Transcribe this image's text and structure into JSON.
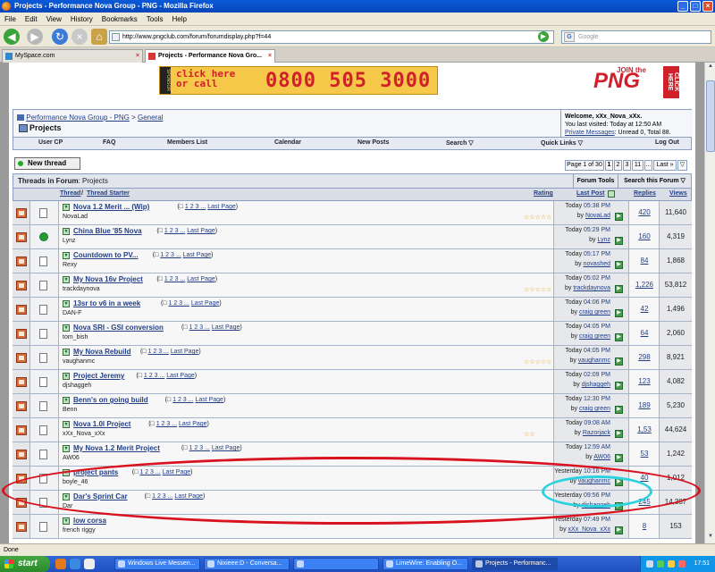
{
  "window": {
    "title": "Projects - Performance Nova Group - PNG - Mozilla Firefox"
  },
  "menu": [
    "File",
    "Edit",
    "View",
    "History",
    "Bookmarks",
    "Tools",
    "Help"
  ],
  "nav": {
    "url": "http://www.pngclub.com/forum/forumdisplay.php?f=44",
    "search_placeholder": "Google"
  },
  "tabs": [
    {
      "label": "MySpace.com"
    },
    {
      "label": "Projects - Performance Nova Gro..."
    }
  ],
  "banner": {
    "sponsor": "SPONSOR",
    "line1": "click here",
    "line2": "or call",
    "phone": "0800 505 3000",
    "png_join": "JOIN the",
    "png": "PNG",
    "png_click": "CLICK HERE"
  },
  "breadcrumb": {
    "home": "Performance Nova Group - PNG",
    "sep": ">",
    "section": "General",
    "current": "Projects"
  },
  "welcome": {
    "line1": "Welcome, xXx_Nova_xXx.",
    "line2": "You last visited: Today at 12:50 AM",
    "pm_link": "Private Messages",
    "pm_text": ": Unread 0, Total 88."
  },
  "forum_menu": [
    "User CP",
    "FAQ",
    "Members List",
    "Calendar",
    "New Posts",
    "Search ▽",
    "Quick Links ▽",
    "Log Out"
  ],
  "buttons": {
    "new_thread": "New thread"
  },
  "pagenav": {
    "label": "Page 1 of 30",
    "pages": [
      "1",
      "2",
      "3",
      "11",
      "...",
      "Last »",
      "▽"
    ]
  },
  "table": {
    "title": "Threads in Forum",
    "subtitle": ": Projects",
    "forum_tools": "Forum Tools ▽",
    "search_forum": "Search this Forum ▽",
    "headers": {
      "thread": "Thread",
      "slash": "/",
      "starter": "Thread Starter",
      "rating": "Rating",
      "lastpost": "Last Post",
      "replies": "Replies",
      "views": "Views"
    }
  },
  "threads": [
    {
      "title": "Nova 1.2 Merit ... (Wip)",
      "pages": "1 2 3 ...",
      "last": "Last Page",
      "starter": "NovaLad",
      "stars": "☆☆☆☆☆",
      "day": "Today",
      "time": "05:38 PM",
      "by": "by",
      "user": "NovaLad",
      "replies": "420",
      "views": "11,640"
    },
    {
      "title": "China Blue '85 Nova",
      "pages": "1 2 3 ...",
      "last": "Last Page",
      "starter": "Lynz",
      "stars": "",
      "day": "Today",
      "time": "05:29 PM",
      "by": "by",
      "user": "Lynz",
      "replies": "160",
      "views": "4,319"
    },
    {
      "title": "Countdown to PV...",
      "pages": "1 2 3 ...",
      "last": "Last Page",
      "starter": "Rexy",
      "stars": "",
      "day": "Today",
      "time": "05:17 PM",
      "by": "by",
      "user": "novashed",
      "replies": "84",
      "views": "1,868"
    },
    {
      "title": "My Nova 16v Project",
      "pages": "1 2 3 ...",
      "last": "Last Page",
      "starter": "trackdaynova",
      "stars": "☆☆☆☆☆",
      "day": "Today",
      "time": "05:02 PM",
      "by": "by",
      "user": "trackdaynova",
      "replies": "1,226",
      "views": "53,812"
    },
    {
      "title": "13sr to v6 in a week",
      "pages": "1 2 3 ...",
      "last": "Last Page",
      "starter": "DAN-F",
      "stars": "",
      "day": "Today",
      "time": "04:06 PM",
      "by": "by",
      "user": "craig green",
      "replies": "42",
      "views": "1,496"
    },
    {
      "title": "Nova SRI - GSI conversion",
      "pages": "1 2 3 ...",
      "last": "Last Page",
      "starter": "tom_bish",
      "stars": "",
      "day": "Today",
      "time": "04:05 PM",
      "by": "by",
      "user": "craig green",
      "replies": "64",
      "views": "2,060"
    },
    {
      "title": "My Nova Rebuild",
      "pages": "1 2 3 ...",
      "last": "Last Page",
      "starter": "vaughanmc",
      "stars": "☆☆☆☆☆",
      "day": "Today",
      "time": "04:05 PM",
      "by": "by",
      "user": "vaughanmc",
      "replies": "298",
      "views": "8,921"
    },
    {
      "title": "Project Jeremy",
      "pages": "1 2 3 ...",
      "last": "Last Page",
      "starter": "djshaggeh",
      "stars": "",
      "day": "Today",
      "time": "02:09 PM",
      "by": "by",
      "user": "djshaggeh",
      "replies": "123",
      "views": "4,082"
    },
    {
      "title": "Benn's on going build",
      "pages": "1 2 3 ...",
      "last": "Last Page",
      "starter": "Benn",
      "stars": "",
      "day": "Today",
      "time": "12:30 PM",
      "by": "by",
      "user": "craig green",
      "replies": "189",
      "views": "5,230"
    },
    {
      "title": "Nova 1.0l Project",
      "pages": "1 2 3 ...",
      "last": "Last Page",
      "starter": "xXx_Nova_xXx",
      "stars": "☆☆",
      "day": "Today",
      "time": "09:08 AM",
      "by": "by",
      "user": "Razorjack",
      "replies": "1,53",
      "views": "44,624"
    },
    {
      "title": "My Nova 1.2 Merit Project",
      "pages": "1 2 3 ...",
      "last": "Last Page",
      "starter": "AW06",
      "stars": "",
      "day": "Today",
      "time": "12:59 AM",
      "by": "by",
      "user": "AW06",
      "replies": "53",
      "views": "1,242"
    },
    {
      "title": "project pants",
      "pages": "1 2 3 ...",
      "last": "Last Page",
      "starter": "boyle_46",
      "stars": "",
      "day": "Yesterday",
      "time": "10:16 PM",
      "by": "by",
      "user": "vaughanmc",
      "replies": "40",
      "views": "1,012"
    },
    {
      "title": "Dar's Sprint Car",
      "pages": "1 2 3 ...",
      "last": "Last Page",
      "starter": "Dar",
      "stars": "",
      "day": "Yesterday",
      "time": "09:56 PM",
      "by": "by",
      "user": "djshaggeh",
      "replies": "245",
      "views": "14,387"
    },
    {
      "title": "low corsa",
      "pages": "",
      "last": "",
      "starter": "french riggy",
      "stars": "",
      "day": "Yesterday",
      "time": "07:49 PM",
      "by": "by",
      "user": "xXx_Nova_xXx",
      "replies": "8",
      "views": "153"
    }
  ],
  "status": "Done",
  "taskbar": {
    "start": "start",
    "tasks": [
      "Windows Live Messen...",
      "Nixieee:D - Conversa...",
      "",
      "LimeWire: Enabling O...",
      "Projects - Performanc..."
    ],
    "clock": "17:51"
  }
}
